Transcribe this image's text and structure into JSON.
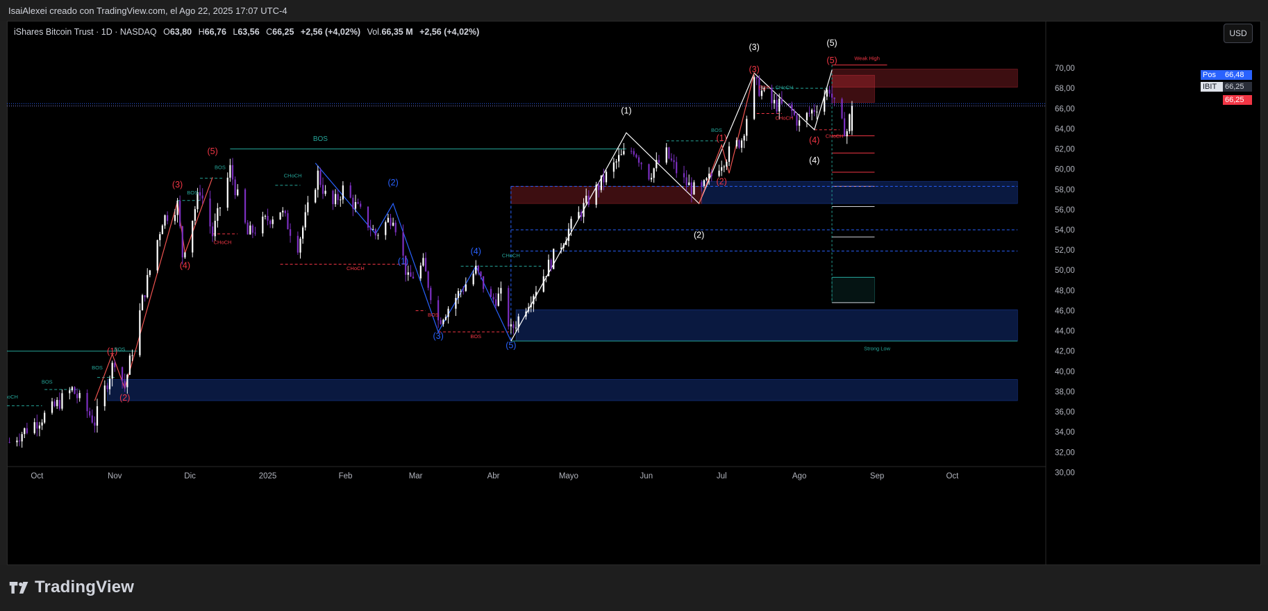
{
  "header": {
    "attribution": "IsaiAlexei creado con TradingView.com, el Ago 22, 2025 17:07 UTC-4"
  },
  "legend": {
    "symbol": "iShares Bitcoin Trust · 1D · NASDAQ",
    "o_label": "O",
    "o": "63,80",
    "h_label": "H",
    "h": "66,76",
    "l_label": "L",
    "l": "63,56",
    "c_label": "C",
    "c": "66,25",
    "change": "+2,56 (+4,02%)",
    "vol_label": "Vol.",
    "vol": "66,35 M",
    "vol_change": "+2,56 (+4,02%)"
  },
  "price_scale": {
    "currency_button": "USD",
    "pos_label": "Pos",
    "pos_value": "66,48",
    "ticker_label": "IBIT",
    "ticker_value": "66,25",
    "last_value": "66,25"
  },
  "brand": {
    "name": "TradingView"
  },
  "colors": {
    "up": "#ffffff",
    "down": "#7b2fbf",
    "bullish_wave": "#ef5350",
    "bearish_wave": "#2962ff",
    "structure_bull": "#26a69a",
    "structure_bear": "#f23645",
    "wave_white": "#ffffff"
  },
  "chart_data": {
    "type": "candlestick",
    "title": "iShares Bitcoin Trust · 1D · NASDAQ",
    "xlabel": "",
    "ylabel": "",
    "ylim": [
      29,
      71.5
    ],
    "x_ticks": [
      "Oct",
      "Nov",
      "Dic",
      "2025",
      "Feb",
      "Mar",
      "Abr",
      "Mayo",
      "Jun",
      "Jul",
      "Ago",
      "Sep",
      "Oct"
    ],
    "y_ticks": [
      "30,00",
      "32,00",
      "34,00",
      "36,00",
      "38,00",
      "40,00",
      "42,00",
      "44,00",
      "46,00",
      "48,00",
      "50,00",
      "52,00",
      "54,00",
      "56,00",
      "58,00",
      "60,00",
      "62,00",
      "64,00",
      "66,00",
      "68,00",
      "70,00"
    ],
    "grid": false,
    "anchors": [
      [
        "2024-09-20",
        33.0
      ],
      [
        "2024-10-06",
        36.0
      ],
      [
        "2024-10-15",
        38.2
      ],
      [
        "2024-10-24",
        35.0
      ],
      [
        "2024-10-29",
        39.0
      ],
      [
        "2024-11-01",
        41.2
      ],
      [
        "2024-11-05",
        38.5
      ],
      [
        "2024-11-12",
        47.0
      ],
      [
        "2024-11-20",
        55.0
      ],
      [
        "2024-11-26",
        56.5
      ],
      [
        "2024-11-28",
        51.5
      ],
      [
        "2024-12-05",
        58.0
      ],
      [
        "2024-12-10",
        53.5
      ],
      [
        "2024-12-17",
        60.0
      ],
      [
        "2024-12-24",
        53.5
      ],
      [
        "2025-01-06",
        56.0
      ],
      [
        "2025-01-13",
        52.5
      ],
      [
        "2025-01-21",
        59.5
      ],
      [
        "2025-01-26",
        56.0
      ],
      [
        "2025-01-31",
        58.0
      ],
      [
        "2025-02-09",
        55.0
      ],
      [
        "2025-02-13",
        53.5
      ],
      [
        "2025-02-20",
        55.5
      ],
      [
        "2025-02-26",
        49.0
      ],
      [
        "2025-03-04",
        50.5
      ],
      [
        "2025-03-10",
        45.0
      ],
      [
        "2025-03-19",
        48.0
      ],
      [
        "2025-03-25",
        50.0
      ],
      [
        "2025-03-31",
        47.0
      ],
      [
        "2025-04-04",
        47.5
      ],
      [
        "2025-04-08",
        44.0
      ],
      [
        "2025-04-15",
        47.0
      ],
      [
        "2025-04-22",
        50.0
      ],
      [
        "2025-05-01",
        54.0
      ],
      [
        "2025-05-09",
        57.0
      ],
      [
        "2025-05-21",
        61.0
      ],
      [
        "2025-05-27",
        62.0
      ],
      [
        "2025-06-02",
        59.5
      ],
      [
        "2025-06-09",
        61.5
      ],
      [
        "2025-06-15",
        59.0
      ],
      [
        "2025-06-22",
        57.5
      ],
      [
        "2025-06-30",
        60.5
      ],
      [
        "2025-07-09",
        63.0
      ],
      [
        "2025-07-14",
        68.5
      ],
      [
        "2025-07-21",
        66.5
      ],
      [
        "2025-07-28",
        66.0
      ],
      [
        "2025-08-01",
        64.5
      ],
      [
        "2025-08-07",
        66.0
      ],
      [
        "2025-08-13",
        68.0
      ],
      [
        "2025-08-17",
        64.5
      ],
      [
        "2025-08-20",
        63.8
      ],
      [
        "2025-08-22",
        66.25
      ]
    ],
    "wave_labels": [
      {
        "text": "(1)",
        "date": "2024-10-31",
        "price": 41.7,
        "color": "red"
      },
      {
        "text": "(2)",
        "date": "2024-11-05",
        "price": 37.1,
        "color": "red"
      },
      {
        "text": "(3)",
        "date": "2024-11-26",
        "price": 58.2,
        "color": "red"
      },
      {
        "text": "(4)",
        "date": "2024-11-29",
        "price": 50.2,
        "color": "red"
      },
      {
        "text": "(5)",
        "date": "2024-12-10",
        "price": 61.5,
        "color": "red"
      },
      {
        "text": "(1)",
        "date": "2025-02-24",
        "price": 50.6,
        "color": "blue"
      },
      {
        "text": "(2)",
        "date": "2025-02-20",
        "price": 58.4,
        "color": "blue"
      },
      {
        "text": "(3)",
        "date": "2025-03-10",
        "price": 43.2,
        "color": "blue"
      },
      {
        "text": "(4)",
        "date": "2025-03-25",
        "price": 51.6,
        "color": "blue"
      },
      {
        "text": "(5)",
        "date": "2025-04-08",
        "price": 42.3,
        "color": "blue"
      },
      {
        "text": "(1)",
        "date": "2025-05-24",
        "price": 65.5,
        "color": "white"
      },
      {
        "text": "(2)",
        "date": "2025-06-22",
        "price": 53.2,
        "color": "white"
      },
      {
        "text": "(3)",
        "date": "2025-07-14",
        "price": 71.8,
        "color": "white"
      },
      {
        "text": "(4)",
        "date": "2025-08-07",
        "price": 60.6,
        "color": "white"
      },
      {
        "text": "(5)",
        "date": "2025-08-14",
        "price": 72.2,
        "color": "white"
      },
      {
        "text": "(1)",
        "date": "2025-07-01",
        "price": 62.8,
        "color": "red"
      },
      {
        "text": "(2)",
        "date": "2025-07-01",
        "price": 58.5,
        "color": "red"
      },
      {
        "text": "(3)",
        "date": "2025-07-14",
        "price": 69.6,
        "color": "red"
      },
      {
        "text": "(4)",
        "date": "2025-08-07",
        "price": 62.6,
        "color": "red"
      },
      {
        "text": "(5)",
        "date": "2025-08-14",
        "price": 70.5,
        "color": "red"
      }
    ],
    "structure_labels": [
      {
        "text": "BOS",
        "date": "2025-01-22",
        "price": 62.8,
        "type": "bull"
      },
      {
        "text": "BOS",
        "date": "2024-12-13",
        "price": 60.0,
        "type": "bull"
      },
      {
        "text": "BOS",
        "date": "2024-12-02",
        "price": 57.5,
        "type": "bull"
      },
      {
        "text": "BOS",
        "date": "2024-11-03",
        "price": 42.0,
        "type": "bull"
      },
      {
        "text": "BOS",
        "date": "2024-10-25",
        "price": 40.2,
        "type": "bull"
      },
      {
        "text": "BOS",
        "date": "2024-10-05",
        "price": 38.8,
        "type": "bull"
      },
      {
        "text": "ChoCH",
        "date": "2024-09-20",
        "price": 37.3,
        "type": "bull"
      },
      {
        "text": "CHoCH",
        "date": "2025-01-11",
        "price": 59.2,
        "type": "bull"
      },
      {
        "text": "CHoCH",
        "date": "2025-04-08",
        "price": 51.3,
        "type": "bull"
      },
      {
        "text": "CHoCH",
        "date": "2024-12-14",
        "price": 52.6,
        "type": "bear"
      },
      {
        "text": "CHoCH",
        "date": "2025-02-05",
        "price": 50.0,
        "type": "bear"
      },
      {
        "text": "BOS",
        "date": "2025-03-08",
        "price": 45.4,
        "type": "bear"
      },
      {
        "text": "BOS",
        "date": "2025-03-25",
        "price": 43.3,
        "type": "bear"
      },
      {
        "text": "BOS",
        "date": "2025-06-29",
        "price": 63.7,
        "type": "bull"
      },
      {
        "text": "EQH",
        "date": "2025-07-18",
        "price": 67.9,
        "type": "bear"
      },
      {
        "text": "CHoCH",
        "date": "2025-07-26",
        "price": 67.9,
        "type": "bull"
      },
      {
        "text": "CHoCH",
        "date": "2025-07-26",
        "price": 64.9,
        "type": "bear"
      },
      {
        "text": "CHoCH",
        "date": "2025-08-15",
        "price": 63.1,
        "type": "bear"
      },
      {
        "text": "Weak High",
        "date": "2025-08-28",
        "price": 70.8,
        "type": "bear"
      },
      {
        "text": "Strong Low",
        "date": "2025-09-01",
        "price": 42.1,
        "type": "bull"
      }
    ],
    "zones": [
      {
        "from": "2024-10-29",
        "to": "2025-10-27",
        "top": 39.2,
        "bottom": 37.1,
        "color": "blue"
      },
      {
        "from": "2025-04-10",
        "to": "2025-10-27",
        "top": 46.1,
        "bottom": 43.0,
        "color": "blue"
      },
      {
        "from": "2025-06-23",
        "to": "2025-10-27",
        "top": 58.8,
        "bottom": 56.6,
        "color": "blue"
      },
      {
        "from": "2025-04-08",
        "to": "2025-06-23",
        "top": 58.3,
        "bottom": 56.6,
        "color": "red"
      },
      {
        "from": "2025-08-14",
        "to": "2025-10-27",
        "top": 69.9,
        "bottom": 68.1,
        "color": "red"
      },
      {
        "from": "2025-08-14",
        "to": "2025-08-31",
        "top": 69.3,
        "bottom": 66.6,
        "color": "red"
      },
      {
        "from": "2025-08-14",
        "to": "2025-08-31",
        "top": 49.3,
        "bottom": 46.8,
        "color": "green"
      }
    ],
    "trade_levels": [
      63.3,
      61.6,
      59.7,
      58.3,
      56.3,
      53.3,
      49.3,
      46.8
    ]
  }
}
